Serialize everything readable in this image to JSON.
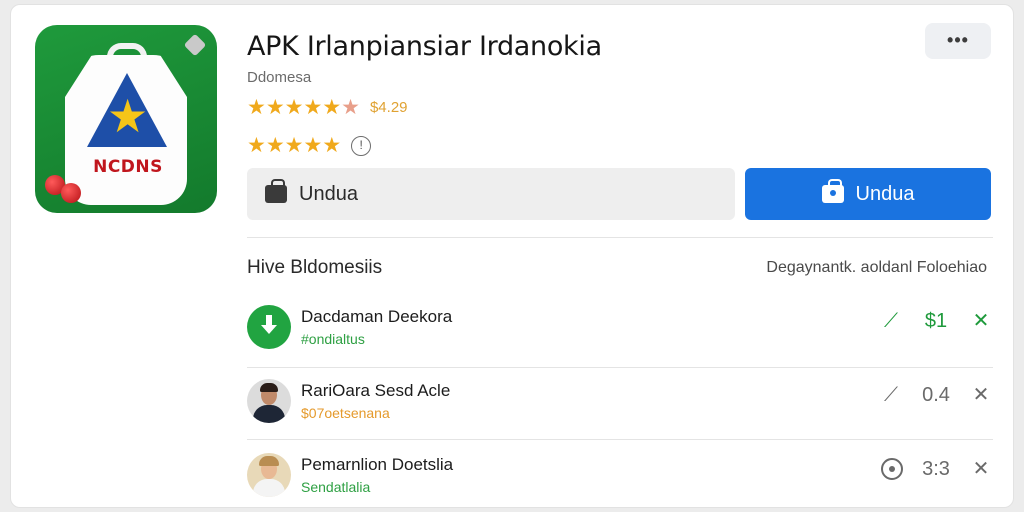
{
  "app": {
    "title": "APK Irlanpiansiar Irdanokia",
    "subtitle": "Ddomesa",
    "brand_text": "NCDNS",
    "rating_price": "$4.29",
    "rating_icon": "info-circle-icon",
    "more_label": "•••"
  },
  "buttons": {
    "secondary_label": "Undua",
    "primary_label": "Undua"
  },
  "section": {
    "title": "Hive Bldomesiis",
    "link": "Degaynantk. aoldanl Foloehiao"
  },
  "list": [
    {
      "name": "Dacdaman Deekora",
      "sub": "#ondialtus",
      "value": "$1"
    },
    {
      "name": "RariOara Sesd Acle",
      "sub": "$07oetsenana",
      "value": "0.4"
    },
    {
      "name": "Pemarnlion Doetslia",
      "sub": "Sendatlalia",
      "value": "3:3"
    }
  ],
  "colors": {
    "primary": "#1a73e0",
    "accent_green": "#21a441",
    "star": "#f0a91c"
  }
}
